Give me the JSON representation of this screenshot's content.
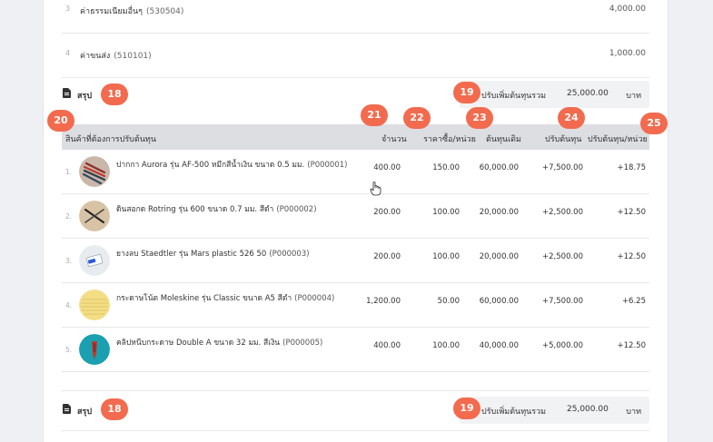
{
  "expenses": [
    {
      "num": "3",
      "name": "ค่าธรรมเนียมอื่นๆ",
      "code": "(530504)",
      "amount": "4,000.00"
    },
    {
      "num": "4",
      "name": "ค่าขนส่ง",
      "code": "(510101)",
      "amount": "1,000.00"
    }
  ],
  "summary": {
    "label": "สรุป",
    "total_label": "ปรับเพิ่มต้นทุนรวม",
    "total_value": "25,000.00",
    "unit": "บาท"
  },
  "table": {
    "headers": {
      "product": "สินค้าที่ต้องการปรับต้นทุน",
      "qty": "จำนวน",
      "price": "ราคาซื้อ/หน่วย",
      "orig_cost": "ต้นทุนเดิม",
      "adj_cost": "ปรับต้นทุน",
      "adj_per_unit": "ปรับต้นทุน/หน่วย"
    },
    "rows": [
      {
        "num": "1.",
        "name": "ปากกา Aurora รุ่น AF-500 หมึกสีน้ำเงิน ขนาด 0.5 มม.",
        "code": "(P000001)",
        "qty": "400.00",
        "price": "150.00",
        "orig": "60,000.00",
        "adj": "+7,500.00",
        "per_unit": "+18.75",
        "thumb": "pen"
      },
      {
        "num": "2.",
        "name": "ดินสอกด Rotring รุ่น 600 ขนาด 0.7 มม. สีดำ",
        "code": "(P000002)",
        "qty": "200.00",
        "price": "100.00",
        "orig": "20,000.00",
        "adj": "+2,500.00",
        "per_unit": "+12.50",
        "thumb": "pencil"
      },
      {
        "num": "3.",
        "name": "ยางลบ Staedtler รุ่น Mars plastic 526 50",
        "code": "(P000003)",
        "qty": "200.00",
        "price": "100.00",
        "orig": "20,000.00",
        "adj": "+2,500.00",
        "per_unit": "+12.50",
        "thumb": "eraser"
      },
      {
        "num": "4.",
        "name": "กระดาษโน้ต Moleskine รุ่น Classic ขนาด A5 สีดำ",
        "code": "(P000004)",
        "qty": "1,200.00",
        "price": "50.00",
        "orig": "60,000.00",
        "adj": "+7,500.00",
        "per_unit": "+6.25",
        "thumb": "notebook"
      },
      {
        "num": "5.",
        "name": "คลิปหนีบกระดาษ Double A ขนาด 32 มม. สีเงิน",
        "code": "(P000005)",
        "qty": "400.00",
        "price": "100.00",
        "orig": "40,000.00",
        "adj": "+5,000.00",
        "per_unit": "+12.50",
        "thumb": "clip"
      }
    ]
  },
  "badges": {
    "summary_top": "18",
    "total_top": "19",
    "product_col": "20",
    "qty_col": "21",
    "price_col": "22",
    "orig_col": "23",
    "adj_col": "24",
    "per_unit_col": "25",
    "summary_bottom": "18",
    "total_bottom": "19"
  },
  "colors": {
    "badge": "#f26b4e",
    "header_bg": "#dcdee2",
    "summary_bg": "#f1f2f4"
  }
}
